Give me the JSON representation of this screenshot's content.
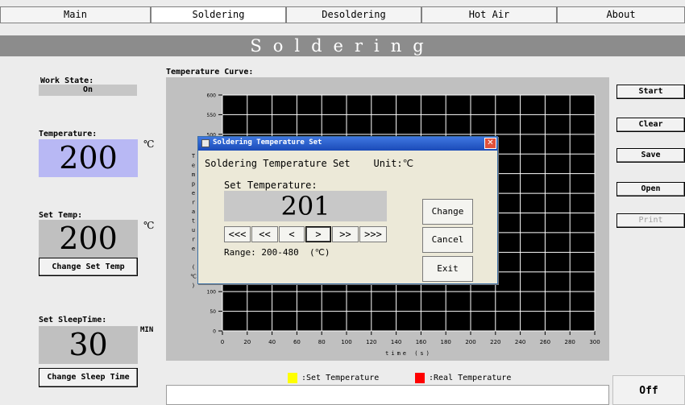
{
  "tabs": [
    "Main",
    "Soldering",
    "Desoldering",
    "Hot Air",
    "About"
  ],
  "banner": "Soldering",
  "work_state": {
    "label": "Work State:",
    "value": "On"
  },
  "temperature": {
    "label": "Temperature:",
    "value": "200",
    "unit": "℃"
  },
  "set_temp": {
    "label": "Set Temp:",
    "value": "200",
    "unit": "℃",
    "button": "Change Set Temp"
  },
  "sleep": {
    "label": "Set SleepTime:",
    "value": "30",
    "unit": "MIN",
    "button": "Change Sleep Time"
  },
  "chart": {
    "title": "Temperature Curve:",
    "xlabel": "time (s)",
    "ylabel": "Temperature (℃)",
    "legend_set": ":Set Temperature",
    "legend_real": ":Real Temperature",
    "colors": {
      "set": "#ffff00",
      "real": "#ff0000",
      "bg": "#000000",
      "grid": "#ffffff"
    }
  },
  "chart_data": {
    "type": "line",
    "title": "",
    "xlabel": "time (s)",
    "ylabel": "Temperature (℃)",
    "x_ticks": [
      0,
      20,
      40,
      60,
      80,
      100,
      120,
      140,
      160,
      180,
      200,
      220,
      240,
      260,
      280,
      300
    ],
    "y_ticks": [
      0,
      50,
      100,
      150,
      200,
      250,
      300,
      350,
      400,
      450,
      500,
      550,
      600
    ],
    "xlim": [
      0,
      300
    ],
    "ylim": [
      0,
      600
    ],
    "grid": true,
    "series": [
      {
        "name": "Set Temperature",
        "values": []
      },
      {
        "name": "Real Temperature",
        "values": []
      }
    ]
  },
  "side_buttons": {
    "start": "Start",
    "clear": "Clear",
    "save": "Save",
    "open": "Open",
    "print": "Print"
  },
  "status": "Off",
  "dialog": {
    "title": "Soldering Temperature Set",
    "heading": "Soldering Temperature Set    Unit:℃",
    "set_label": "Set Temperature:",
    "value": "201",
    "nav": [
      "<<<",
      "<<",
      "<",
      ">",
      ">>",
      ">>>"
    ],
    "range": "Range: 200-480  (℃)",
    "change": "Change",
    "cancel": "Cancel",
    "exit": "Exit"
  }
}
